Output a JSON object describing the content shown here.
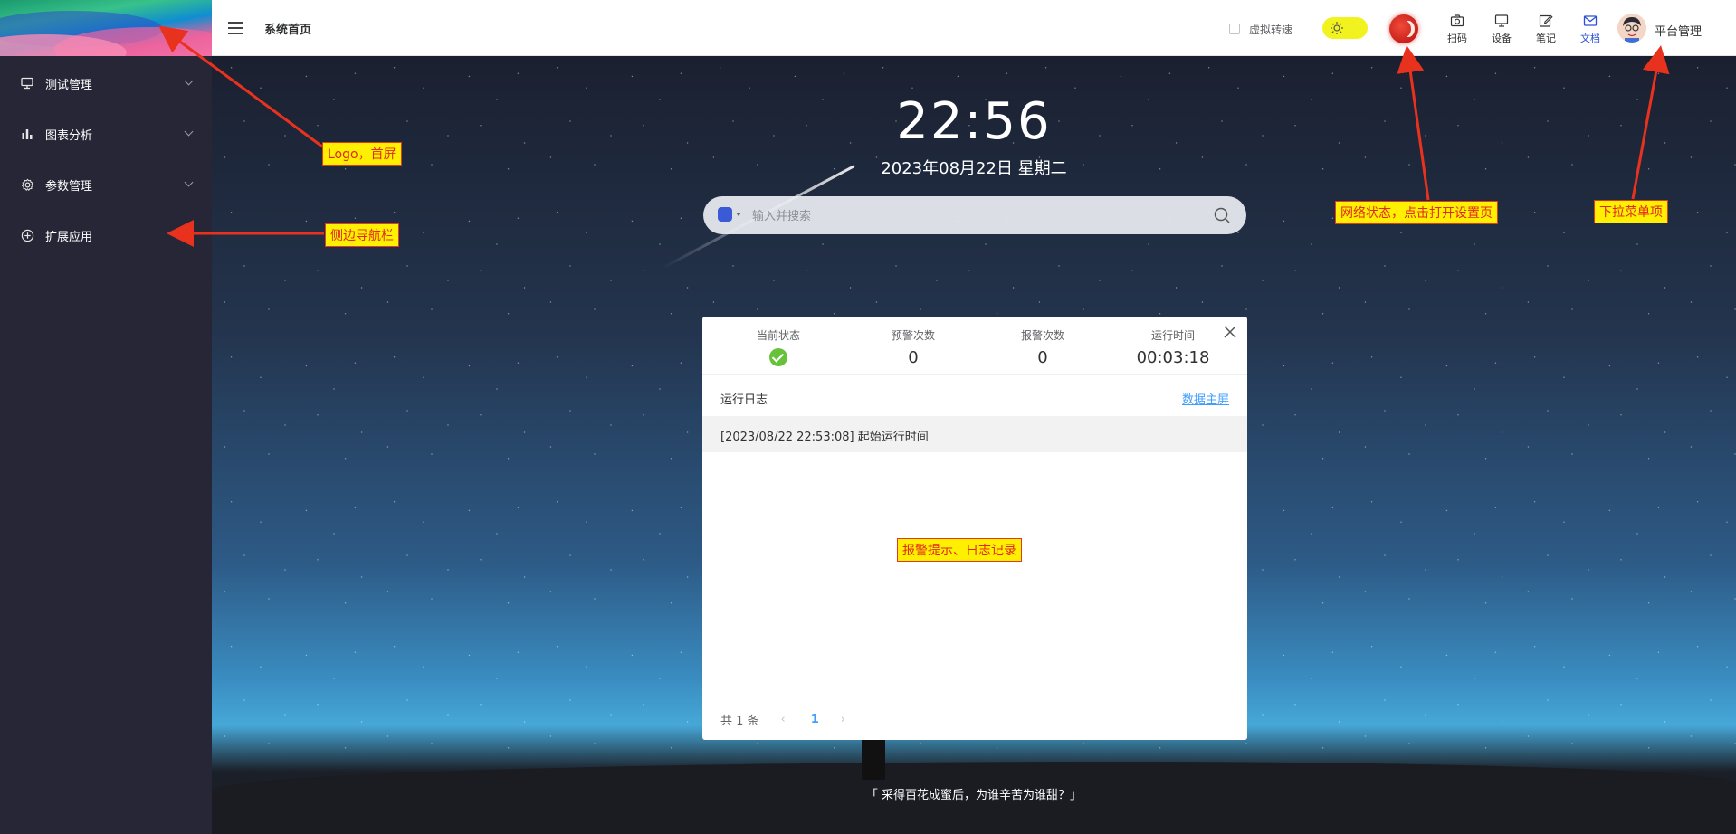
{
  "sidebar": {
    "items": [
      {
        "label": "测试管理",
        "icon": "monitor-icon",
        "has_submenu": true
      },
      {
        "label": "图表分析",
        "icon": "bar-chart-icon",
        "has_submenu": true
      },
      {
        "label": "参数管理",
        "icon": "gear-icon",
        "has_submenu": true
      },
      {
        "label": "扩展应用",
        "icon": "plus-circle-icon",
        "has_submenu": false
      }
    ]
  },
  "header": {
    "title": "系统首页",
    "virtual_speed_label": "虚拟转速",
    "virtual_speed_checked": false,
    "tools": [
      {
        "label": "扫码",
        "icon": "camera-icon"
      },
      {
        "label": "设备",
        "icon": "monitor-icon"
      },
      {
        "label": "笔记",
        "icon": "edit-icon"
      },
      {
        "label": "文档",
        "icon": "mail-icon",
        "active": true
      }
    ],
    "user_name": "平台管理",
    "colors": {
      "toggle": "#f2f21e",
      "network_status": "#d9281c",
      "active_tool": "#2a4fd6"
    }
  },
  "home": {
    "time": "22:56",
    "date": "2023年08月22日 星期二",
    "search_placeholder": "输入并搜索",
    "search_engine_icon": "baidu-paw-icon",
    "quote": "「 采得百花成蜜后，为谁辛苦为谁甜？」"
  },
  "panel": {
    "stats": [
      {
        "label": "当前状态",
        "value": "",
        "icon": "check-circle-icon"
      },
      {
        "label": "预警次数",
        "value": "0"
      },
      {
        "label": "报警次数",
        "value": "0"
      },
      {
        "label": "运行时间",
        "value": "00:03:18"
      }
    ],
    "log_title": "运行日志",
    "log_link": "数据主屏",
    "logs": [
      "[2023/08/22 22:53:08] 起始运行时间"
    ],
    "pagination": {
      "total_text": "共 1 条",
      "current_page": "1"
    }
  },
  "annotations": {
    "logo": "Logo，首屏",
    "sidebar": "侧边导航栏",
    "network": "网络状态，点击打开设置页",
    "dropdown": "下拉菜单项",
    "panel": "报警提示、日志记录"
  }
}
